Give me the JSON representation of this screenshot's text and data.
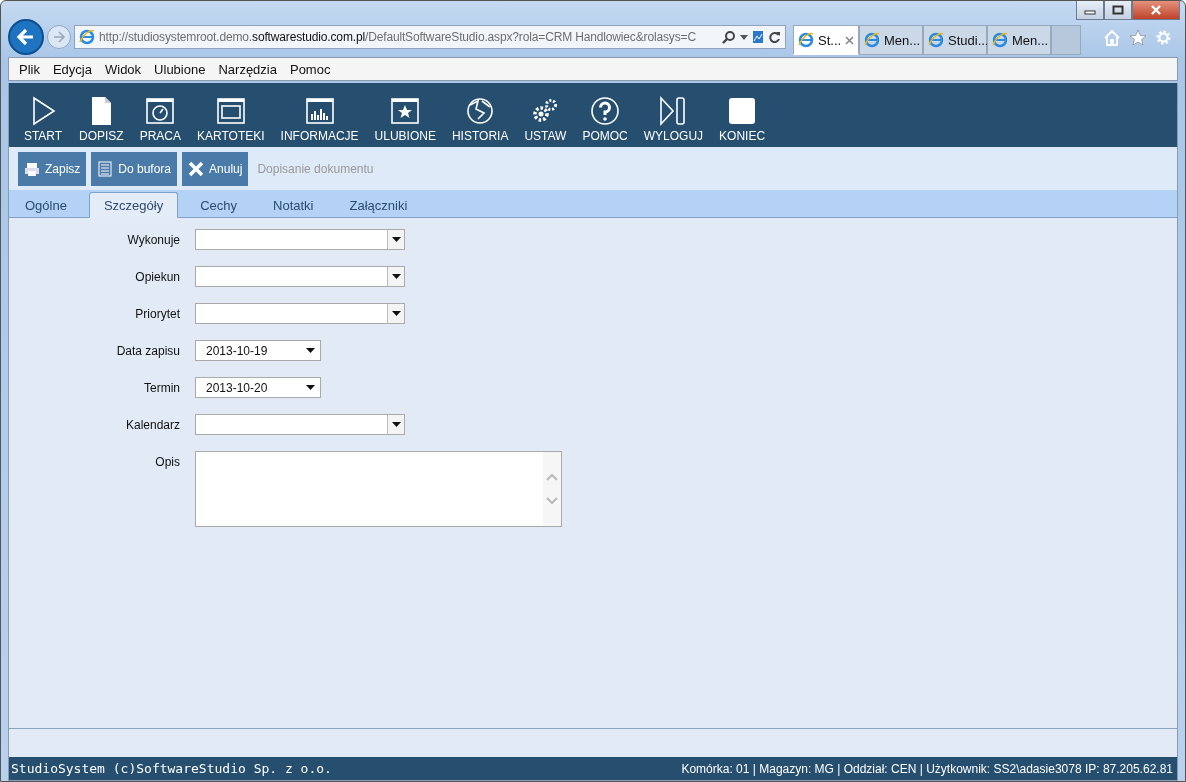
{
  "browser": {
    "url": "http://studiosystemroot.demo.**softwarestudio.com.pl**/DefaultSoftwareStudio.aspx?rola=CRM Handlowiec&rolasys=C",
    "tabs": [
      {
        "label": "St...",
        "selected": true
      },
      {
        "label": "Men...",
        "selected": false
      },
      {
        "label": "Studi...",
        "selected": false
      },
      {
        "label": "Men...",
        "selected": false
      }
    ],
    "menu": [
      "Plik",
      "Edycja",
      "Widok",
      "Ulubione",
      "Narzędzia",
      "Pomoc"
    ]
  },
  "toolbar": [
    {
      "label": "START",
      "kind": "play"
    },
    {
      "label": "DOPISZ",
      "kind": "page"
    },
    {
      "label": "PRACA",
      "kind": "gauge"
    },
    {
      "label": "KARTOTEKI",
      "kind": "window"
    },
    {
      "label": "INFORMACJE",
      "kind": "chart"
    },
    {
      "label": "ULUBIONE",
      "kind": "star"
    },
    {
      "label": "HISTORIA",
      "kind": "globe"
    },
    {
      "label": "USTAW",
      "kind": "gears"
    },
    {
      "label": "POMOC",
      "kind": "help"
    },
    {
      "label": "WYLOGUJ",
      "kind": "logout"
    },
    {
      "label": "KONIEC",
      "kind": "stop"
    }
  ],
  "actions": [
    {
      "label": "Zapisz",
      "kind": "save"
    },
    {
      "label": "Do bufora",
      "kind": "list"
    },
    {
      "label": "Anuluj",
      "kind": "cancel"
    }
  ],
  "action_title": "Dopisanie dokumentu",
  "tabs": [
    {
      "label": "Ogólne",
      "selected": false
    },
    {
      "label": "Szczegóły",
      "selected": true
    },
    {
      "label": "Cechy",
      "selected": false
    },
    {
      "label": "Notatki",
      "selected": false
    },
    {
      "label": "Załączniki",
      "selected": false
    }
  ],
  "fields": [
    {
      "label": "Wykonuje",
      "kind": "combo"
    },
    {
      "label": "Opiekun",
      "kind": "combo"
    },
    {
      "label": "Priorytet",
      "kind": "combo"
    },
    {
      "label": "Data zapisu",
      "kind": "date",
      "value": "2013-10-19"
    },
    {
      "label": "Termin",
      "kind": "date",
      "value": "2013-10-20"
    },
    {
      "label": "Kalendarz",
      "kind": "combo"
    },
    {
      "label": "Opis",
      "kind": "textarea"
    }
  ],
  "status_bar": {
    "left": "StudioSystem (c)SoftwareStudio Sp. z o.o.",
    "right": "Komórka: 01 | Magazyn: MG | Oddział: CEN | Użytkownik: SS2\\adasie3078 IP: 87.205.62.81"
  }
}
